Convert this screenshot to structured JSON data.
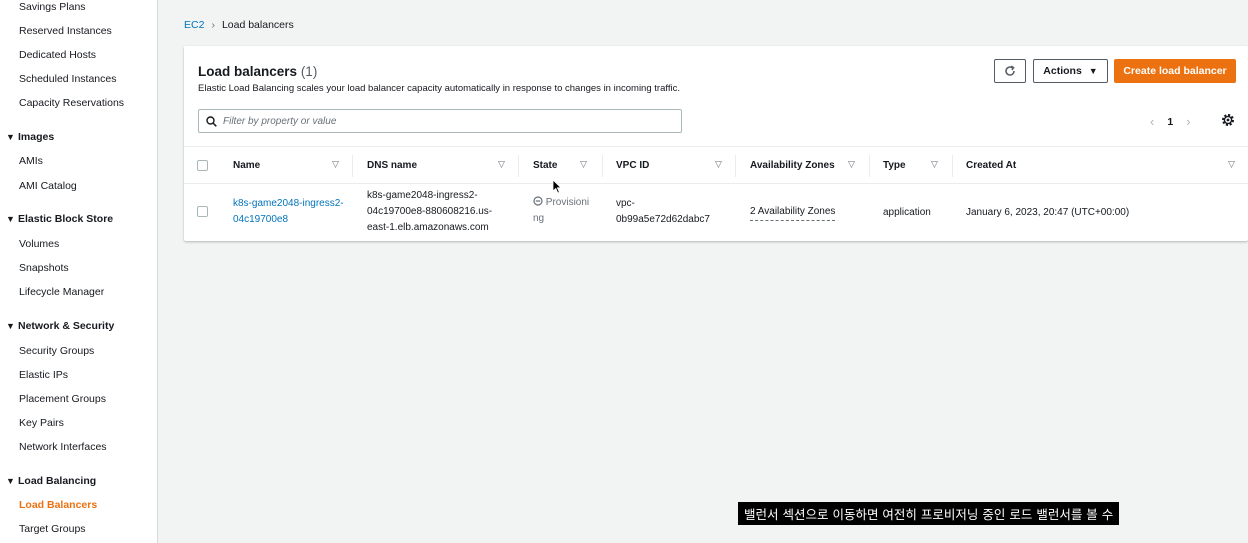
{
  "sidebar": {
    "items_top": [
      {
        "label": "Savings Plans"
      },
      {
        "label": "Reserved Instances"
      },
      {
        "label": "Dedicated Hosts"
      },
      {
        "label": "Scheduled Instances"
      },
      {
        "label": "Capacity Reservations"
      }
    ],
    "sections": [
      {
        "title": "Images",
        "items": [
          "AMIs",
          "AMI Catalog"
        ]
      },
      {
        "title": "Elastic Block Store",
        "items": [
          "Volumes",
          "Snapshots",
          "Lifecycle Manager"
        ]
      },
      {
        "title": "Network & Security",
        "items": [
          "Security Groups",
          "Elastic IPs",
          "Placement Groups",
          "Key Pairs",
          "Network Interfaces"
        ]
      },
      {
        "title": "Load Balancing",
        "items": [
          "Load Balancers",
          "Target Groups"
        ]
      }
    ],
    "active_item": "Load Balancers"
  },
  "breadcrumb": {
    "root": "EC2",
    "current": "Load balancers"
  },
  "panel": {
    "title": "Load balancers",
    "count": "(1)",
    "description": "Elastic Load Balancing scales your load balancer capacity automatically in response to changes in incoming traffic.",
    "actions_label": "Actions",
    "create_label": "Create load balancer",
    "search_placeholder": "Filter by property or value",
    "page_number": "1"
  },
  "table": {
    "columns": [
      "Name",
      "DNS name",
      "State",
      "VPC ID",
      "Availability Zones",
      "Type",
      "Created At"
    ],
    "rows": [
      {
        "name": [
          "k8s-game2048-ingress2-",
          "04c19700e8"
        ],
        "dns": [
          "k8s-game2048-ingress2-",
          "04c19700e8-880608216.us-",
          "east-1.elb.amazonaws.com"
        ],
        "state": [
          "Provisioni",
          "ng"
        ],
        "vpc": [
          "vpc-",
          "0b99a5e72d62dabc7"
        ],
        "az": "2 Availability Zones",
        "type": "application",
        "created": "January 6, 2023, 20:47 (UTC+00:00)"
      }
    ]
  },
  "colors": {
    "accent": "#ec7211",
    "link": "#0073bb"
  },
  "subtitle": "밸런서 섹션으로 이동하면 여전히 프로비저닝 중인 로드 밸런서를 볼 수"
}
